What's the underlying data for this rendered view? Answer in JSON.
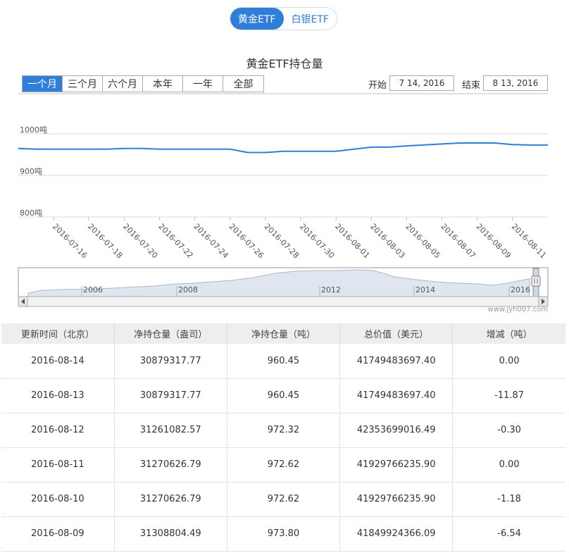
{
  "tabs": [
    "黄金ETF",
    "白银ETF"
  ],
  "chart_title": "黄金ETF持仓量",
  "range_buttons": [
    "一个月",
    "三个月",
    "六个月",
    "本年",
    "一年",
    "全部"
  ],
  "date_range": {
    "start_label": "开始",
    "start_value": "7 14, 2016",
    "end_label": "结束",
    "end_value": "8 13, 2016"
  },
  "chart_data": {
    "type": "line",
    "x": [
      "2016-07-14",
      "2016-07-15",
      "2016-07-18",
      "2016-07-19",
      "2016-07-20",
      "2016-07-21",
      "2016-07-22",
      "2016-07-25",
      "2016-07-26",
      "2016-07-27",
      "2016-07-28",
      "2016-07-29",
      "2016-08-01",
      "2016-08-02",
      "2016-08-03",
      "2016-08-04",
      "2016-08-05",
      "2016-08-08",
      "2016-08-09",
      "2016-08-10",
      "2016-08-11",
      "2016-08-12",
      "2016-08-13"
    ],
    "series": [
      {
        "values": [
          965,
          963,
          963,
          963,
          965,
          965,
          963,
          963,
          963,
          955,
          955,
          958,
          958,
          963,
          968,
          968,
          971,
          978,
          978,
          978,
          974,
          973,
          973
        ]
      }
    ],
    "x_tick_labels": [
      "2016-07-16",
      "2016-07-18",
      "2016-07-20",
      "2016-07-22",
      "2016-07-24",
      "2016-07-26",
      "2016-07-28",
      "2016-07-30",
      "2016-08-01",
      "2016-08-03",
      "2016-08-05",
      "2016-08-07",
      "2016-08-09",
      "2016-08-11"
    ],
    "y_ticks": [
      {
        "value": 1000,
        "label": "1000吨"
      },
      {
        "value": 900,
        "label": "900吨"
      },
      {
        "value": 800,
        "label": "800吨"
      }
    ],
    "ylim": [
      800,
      1000
    ],
    "grid": true,
    "line_color": "#2f7ed8",
    "navigator_years": [
      "2006",
      "2008",
      "2012",
      "2014",
      "2016"
    ]
  },
  "watermark": "www.jyh007.com",
  "table": {
    "headers": [
      "更新时间（北京）",
      "净持仓量（盎司）",
      "净持仓量（吨）",
      "总价值（美元）",
      "增减（吨）"
    ],
    "rows": [
      [
        "2016-08-14",
        "30879317.77",
        "960.45",
        "41749483697.40",
        "0.00"
      ],
      [
        "2016-08-13",
        "30879317.77",
        "960.45",
        "41749483697.40",
        "-11.87"
      ],
      [
        "2016-08-12",
        "31261082.57",
        "972.32",
        "42353699016.49",
        "-0.30"
      ],
      [
        "2016-08-11",
        "31270626.79",
        "972.62",
        "41929766235.90",
        "0.00"
      ],
      [
        "2016-08-10",
        "31270626.79",
        "972.62",
        "41929766235.90",
        "-1.18"
      ],
      [
        "2016-08-09",
        "31308804.49",
        "973.80",
        "41849924366.09",
        "-6.54"
      ]
    ]
  }
}
